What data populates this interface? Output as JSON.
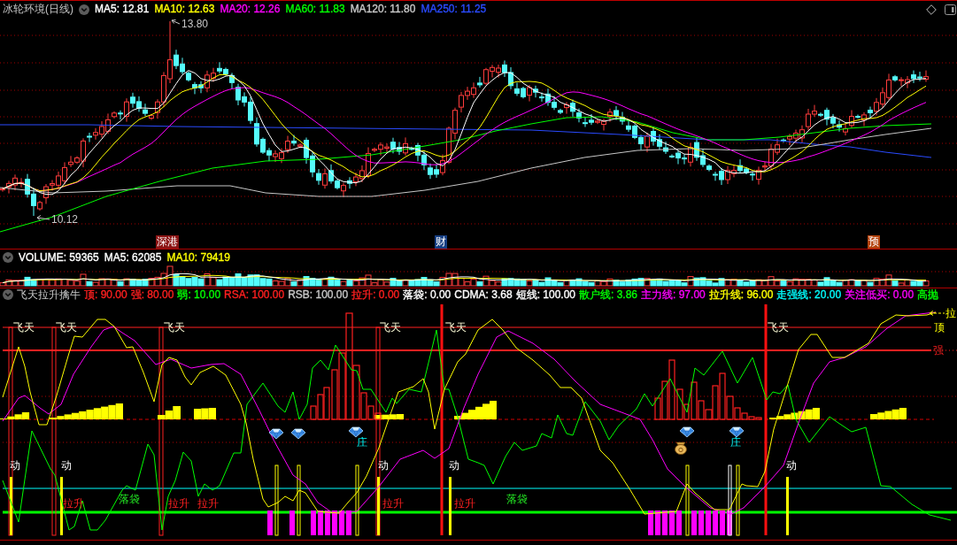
{
  "price_pane": {
    "title": "冰轮环境(日线)",
    "legend": [
      {
        "label": "MA5: 12.81",
        "color": "#ffffff"
      },
      {
        "label": "MA10: 12.63",
        "color": "#ffff00"
      },
      {
        "label": "MA20: 12.26",
        "color": "#ff00ff"
      },
      {
        "label": "MA60: 11.83",
        "color": "#00ff00"
      },
      {
        "label": "MA120: 11.80",
        "color": "#c8c8c8"
      },
      {
        "label": "MA250: 11.25",
        "color": "#2a4bff"
      }
    ],
    "high_label": "13.80",
    "low_label": "10.12",
    "events": [
      {
        "label": "深港",
        "color": "#8c1414"
      },
      {
        "label": "财",
        "color": "#163e82"
      },
      {
        "label": "预",
        "color": "#b4420c"
      }
    ]
  },
  "volume_pane": {
    "legend": [
      {
        "label": "VOLUME: 59365",
        "color": "#ffffff"
      },
      {
        "label": "MA5: 62085",
        "color": "#ffffff"
      },
      {
        "label": "MA10: 79419",
        "color": "#ffff00"
      }
    ]
  },
  "indicator_pane": {
    "title": "飞天拉升擒牛",
    "legend": [
      {
        "label": "顶: 90.00",
        "color": "#ff2020"
      },
      {
        "label": "强: 80.00",
        "color": "#ff2020"
      },
      {
        "label": "弱: 10.00",
        "color": "#00ff00"
      },
      {
        "label": "RSA: 100.00",
        "color": "#ff2020"
      },
      {
        "label": "RSB: 100.00",
        "color": "#c8c8c8"
      },
      {
        "label": "拉升: 0.00",
        "color": "#ff2020"
      },
      {
        "label": "落袋: 0.00",
        "color": "#ffffff"
      },
      {
        "label": "CDMA: 3.68",
        "color": "#ffffff"
      },
      {
        "label": "短线: 100.00",
        "color": "#ffffff"
      },
      {
        "label": "散户线: 3.86",
        "color": "#00ff00"
      },
      {
        "label": "主力线: 97.00",
        "color": "#ff00ff"
      },
      {
        "label": "拉升线: 96.00",
        "color": "#ffff00"
      },
      {
        "label": "走强线: 20.00",
        "color": "#00ffff"
      },
      {
        "label": "关注低买: 0.00",
        "color": "#ff00ff"
      },
      {
        "label": "高抛",
        "color": "#00ff00"
      }
    ],
    "flight_marks": [
      "飞天",
      "飞天",
      "飞天",
      "飞天",
      "飞天",
      "飞天"
    ],
    "move_marks": [
      "动",
      "动",
      "动",
      "动",
      "动"
    ],
    "rise_marks": [
      "拉升",
      "拉升",
      "拉升",
      "拉升",
      "拉升"
    ],
    "pocket_marks": [
      "落袋",
      "落袋"
    ],
    "dealer_marks": [
      "庄",
      "庄"
    ],
    "level_labels": [
      "顶",
      "强"
    ],
    "edge_label": "拉"
  }
}
